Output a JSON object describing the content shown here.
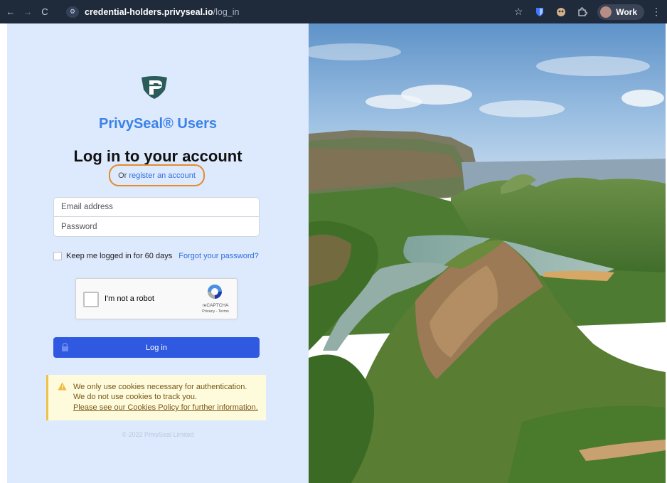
{
  "browser": {
    "back_icon": "arrow-left-icon",
    "forward_icon": "arrow-right-icon",
    "reload_icon": "reload-icon",
    "url_host": "credential-holders.privyseal.io",
    "url_path": "/log_in",
    "profile_label": "Work"
  },
  "login": {
    "brand": "PrivySeal® Users",
    "heading": "Log in to your account",
    "register_prefix": "Or",
    "register_link": "register an account",
    "email_placeholder": "Email address",
    "password_placeholder": "Password",
    "keep_logged_in": "Keep me logged in for 60 days",
    "forgot_password": "Forgot your password?",
    "recaptcha_label": "I'm not a robot",
    "recaptcha_brand": "reCAPTCHA",
    "recaptcha_links": "Privacy - Terms",
    "login_button": "Log in",
    "cookie_line1": "We only use cookies necessary for authentication.",
    "cookie_line2": "We do not use cookies to track you.",
    "cookie_link": "Please see our Cookies Policy for further information.",
    "copyright": "© 2022 PrivySeal Limited"
  },
  "colors": {
    "panel_bg": "#dde9fd",
    "brand_blue": "#3a82e8",
    "button_blue": "#2f59e0",
    "highlight_orange": "#e58b2a",
    "warning_bg": "#fdfbdc"
  }
}
